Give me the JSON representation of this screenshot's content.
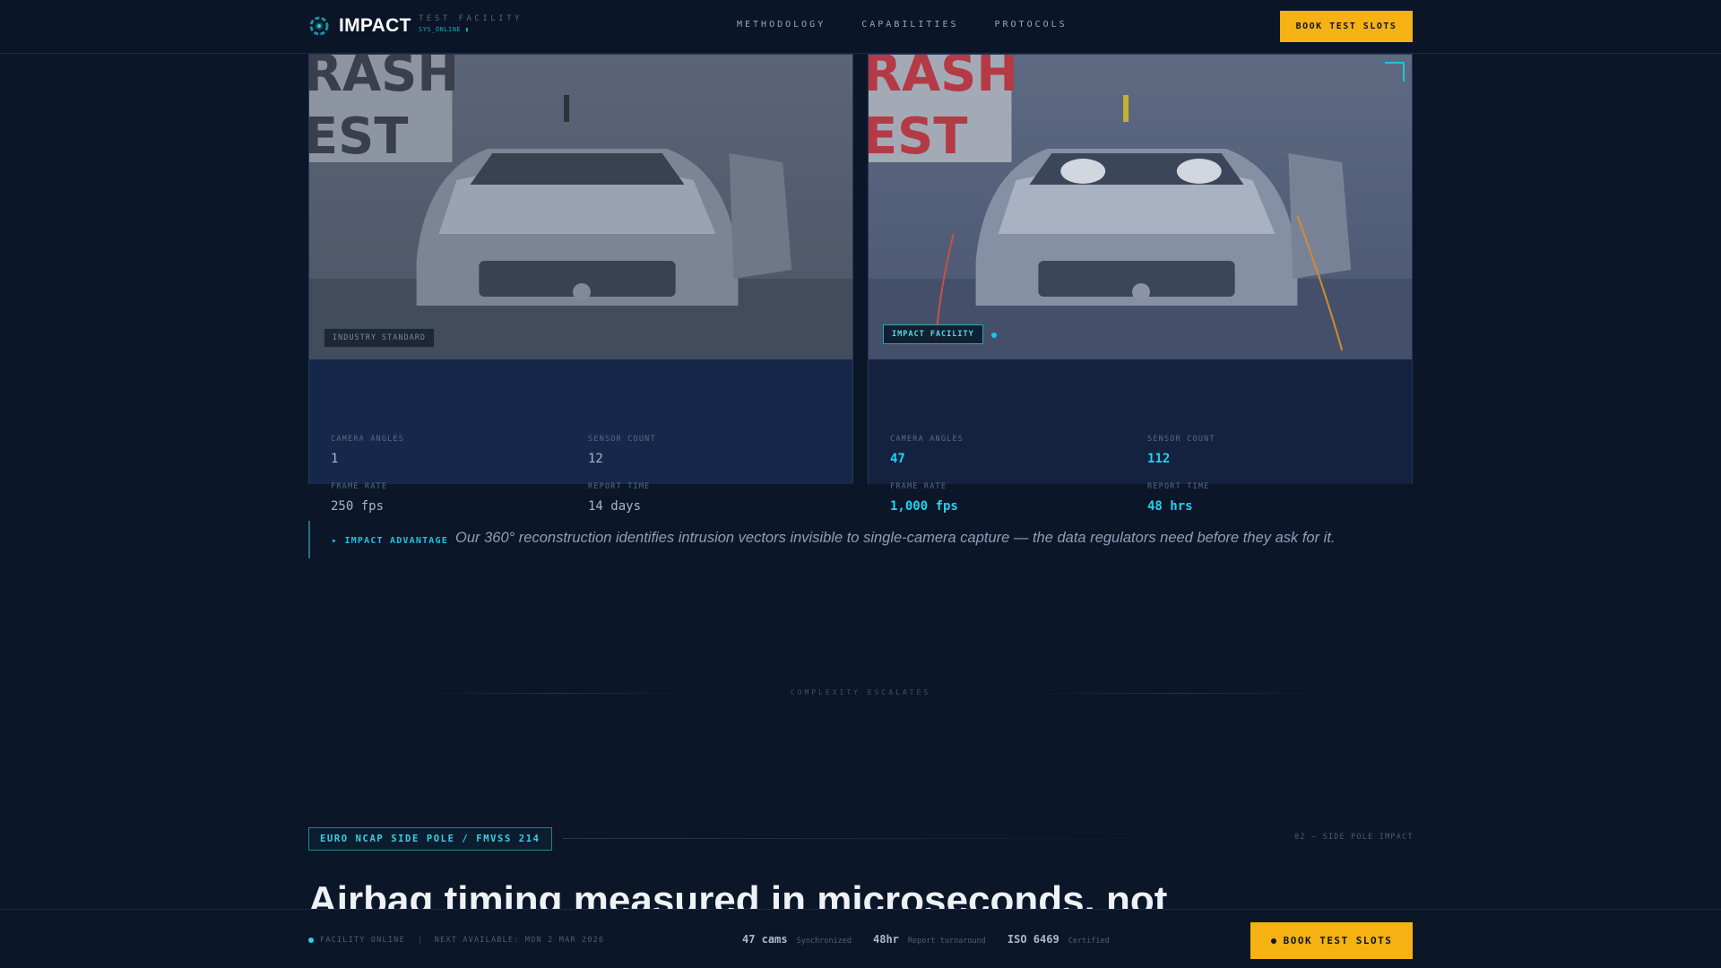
{
  "header": {
    "logo_text": "IMPACT",
    "logo_sub": "TEST FACILITY",
    "logo_status": "SYS_ONLINE ▮",
    "nav": [
      "METHODOLOGY",
      "CAPABILITIES",
      "PROTOCOLS"
    ],
    "cta": "BOOK TEST SLOTS"
  },
  "comparison": {
    "left": {
      "tag": "INDUSTRY STANDARD",
      "stats": [
        {
          "label": "CAMERA ANGLES",
          "value": "1"
        },
        {
          "label": "SENSOR COUNT",
          "value": "12"
        },
        {
          "label": "FRAME RATE",
          "value": "250 fps"
        },
        {
          "label": "REPORT TIME",
          "value": "14 days"
        }
      ]
    },
    "right": {
      "tag": "IMPACT FACILITY",
      "stats": [
        {
          "label": "CAMERA ANGLES",
          "value": "47"
        },
        {
          "label": "SENSOR COUNT",
          "value": "112"
        },
        {
          "label": "FRAME RATE",
          "value": "1,000 fps"
        },
        {
          "label": "REPORT TIME",
          "value": "48 hrs"
        }
      ]
    },
    "photo_text": [
      "RASH",
      "EST"
    ]
  },
  "callout": {
    "label": "▸ IMPACT ADVANTAGE",
    "text": "Our 360° reconstruction identifies intrusion vectors invisible to single-camera capture — the data regulators need before they ask for it."
  },
  "divider_text": "COMPLEXITY ESCALATES",
  "section": {
    "tag": "EURO NCAP SIDE POLE / FMVSS 214",
    "right_label": "02 — SIDE POLE IMPACT",
    "headline": "Airbag timing measured in microseconds, not"
  },
  "bottombar": {
    "status": "FACILITY ONLINE",
    "next": "NEXT AVAILABLE: MON 2 MAR 2026",
    "stats": [
      {
        "value": "47 cams",
        "desc": "Synchronized"
      },
      {
        "value": "48hr",
        "desc": "Report turnaround"
      },
      {
        "value": "ISO 6469",
        "desc": "Certified"
      }
    ],
    "cta": "BOOK TEST SLOTS"
  },
  "colors": {
    "background": "#0b1628",
    "accent_cyan": "#22d3ee",
    "accent_yellow": "#f5b212"
  }
}
